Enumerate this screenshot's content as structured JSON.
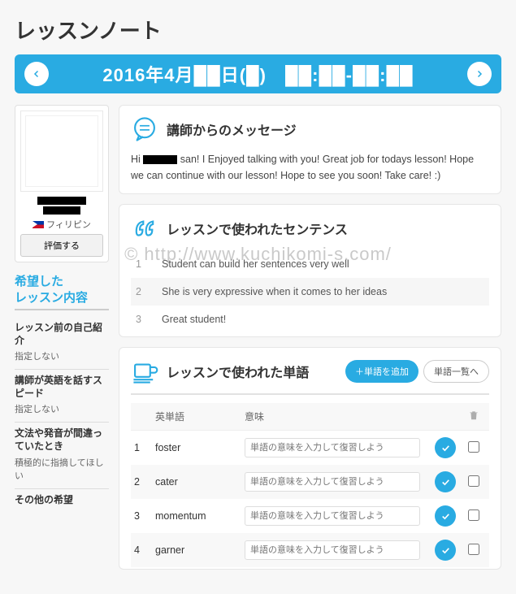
{
  "page_title": "レッスンノート",
  "date_bar": {
    "text": "2016年4月██日(█)　██:██-██:██"
  },
  "profile": {
    "country": "フィリピン",
    "rate_label": "評価する"
  },
  "sidebar": {
    "heading": "希望した\nレッスン内容",
    "items": [
      {
        "q": "レッスン前の自己紹介",
        "a": "指定しない"
      },
      {
        "q": "講師が英語を話すスピード",
        "a": "指定しない"
      },
      {
        "q": "文法や発音が間違っていたとき",
        "a": "積極的に指摘してほしい"
      },
      {
        "q": "その他の希望",
        "a": ""
      }
    ]
  },
  "message": {
    "title": "講師からのメッセージ",
    "body_pre": "Hi ",
    "body_post": " san! I Enjoyed talking with you! Great job for todays lesson! Hope we can continue with our lesson! Hope to see you soon! Take care! :)"
  },
  "sentences": {
    "title": "レッスンで使われたセンテンス",
    "items": [
      "Student can build her sentences very well",
      "She is very expressive when it comes to her ideas",
      "Great student!"
    ]
  },
  "words": {
    "title": "レッスンで使われた単語",
    "add_label": "＋単語を追加",
    "list_label": "単語一覧へ",
    "header_word": "英単語",
    "header_meaning": "意味",
    "placeholder": "単語の意味を入力して復習しよう",
    "items": [
      {
        "n": "1",
        "word": "foster"
      },
      {
        "n": "2",
        "word": "cater"
      },
      {
        "n": "3",
        "word": "momentum"
      },
      {
        "n": "4",
        "word": "garner"
      }
    ]
  },
  "watermark": "© http://www.kuchikomi-s.com/"
}
